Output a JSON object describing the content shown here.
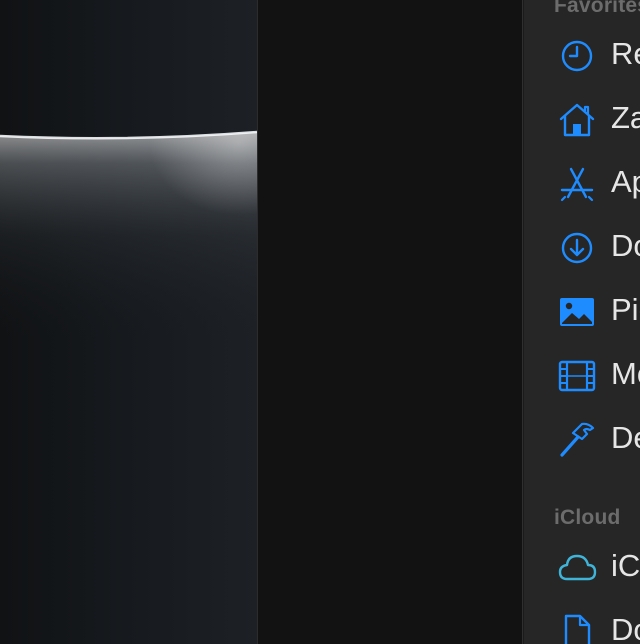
{
  "sidebar": {
    "sections": {
      "favorites": "Favorites",
      "icloud": "iCloud"
    },
    "items": [
      {
        "label": "Recents",
        "icon": "clock-icon"
      },
      {
        "label": "Zadia",
        "icon": "home-icon"
      },
      {
        "label": "Applications",
        "icon": "applications-icon"
      },
      {
        "label": "Downloads",
        "icon": "download-icon"
      },
      {
        "label": "Pictures",
        "icon": "photo-icon"
      },
      {
        "label": "Movies",
        "icon": "film-icon"
      },
      {
        "label": "Developer",
        "icon": "hammer-icon"
      },
      {
        "label": "iCloud Drive",
        "icon": "cloud-icon"
      },
      {
        "label": "Documents",
        "icon": "document-icon"
      }
    ]
  },
  "colors": {
    "accent": "#1e8bff",
    "cloud_accent": "#3fb4d8",
    "sidebar_bg": "#262626",
    "pane_bg": "#121212",
    "section_header": "#6c6c6c",
    "item_text": "#e6e6e6"
  }
}
